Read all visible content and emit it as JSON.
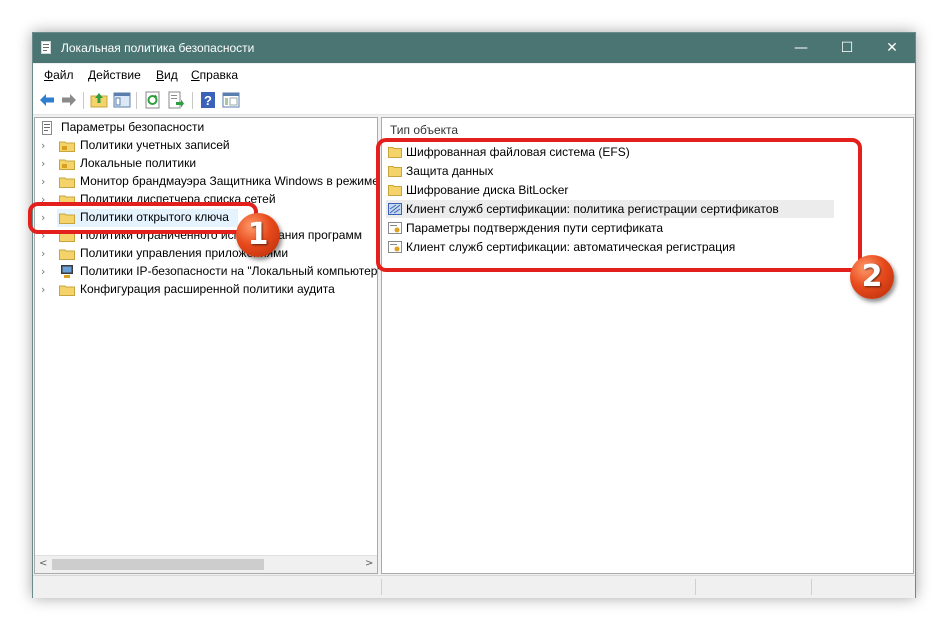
{
  "window": {
    "title": "Локальная политика безопасности",
    "controls": {
      "minimize": "—",
      "maximize": "☐",
      "close": "✕"
    }
  },
  "menu": [
    {
      "prefix": "",
      "accel": "Ф",
      "rest": "айл"
    },
    {
      "prefix": "",
      "accel": "Д",
      "rest": "ействие"
    },
    {
      "prefix": "",
      "accel": "В",
      "rest": "ид"
    },
    {
      "prefix": "",
      "accel": "С",
      "rest": "правка"
    }
  ],
  "toolbar": {
    "buttons": [
      "back-icon",
      "forward-icon",
      "up-folder-icon",
      "show-tree-icon",
      "refresh-icon",
      "export-list-icon",
      "help-icon",
      "properties-icon"
    ]
  },
  "tree": {
    "root": "Параметры безопасности",
    "items": [
      {
        "label": "Политики учетных записей",
        "icon": "locked-folder-icon"
      },
      {
        "label": "Локальные политики",
        "icon": "locked-folder-icon"
      },
      {
        "label": "Монитор брандмауэра Защитника Windows в режиме",
        "icon": "folder-icon"
      },
      {
        "label": "Политики диспетчера списка сетей",
        "icon": "folder-icon"
      },
      {
        "label": "Политики открытого ключа",
        "icon": "folder-icon",
        "selected": true
      },
      {
        "label": "Политики ограниченного использования программ",
        "icon": "folder-icon"
      },
      {
        "label": "Политики управления приложениями",
        "icon": "folder-icon"
      },
      {
        "label": "Политики IP-безопасности на \"Локальный компьютер\"",
        "icon": "ipsec-icon"
      },
      {
        "label": "Конфигурация расширенной политики аудита",
        "icon": "folder-icon"
      }
    ],
    "scroll_left": "<",
    "scroll_right": ">"
  },
  "list": {
    "column_header": "Тип объекта",
    "items": [
      {
        "label": "Шифрованная файловая система (EFS)",
        "icon": "folder-icon"
      },
      {
        "label": "Защита данных",
        "icon": "folder-icon"
      },
      {
        "label": "Шифрование диска BitLocker",
        "icon": "folder-icon"
      },
      {
        "label": "Клиент служб сертификации: политика регистрации сертификатов",
        "icon": "certificate-policy-icon",
        "hover": true
      },
      {
        "label": "Параметры подтверждения пути сертификата",
        "icon": "certificate-settings-icon"
      },
      {
        "label": "Клиент служб сертификации: автоматическая регистрация",
        "icon": "certificate-settings-icon"
      }
    ]
  },
  "annotations": {
    "badge_1": "1",
    "badge_2": "2",
    "highlight_color": "#e3201b"
  },
  "colors": {
    "titlebar": "#4b7573",
    "selection": "#e5f3ff",
    "folder": "#f5d36b"
  }
}
